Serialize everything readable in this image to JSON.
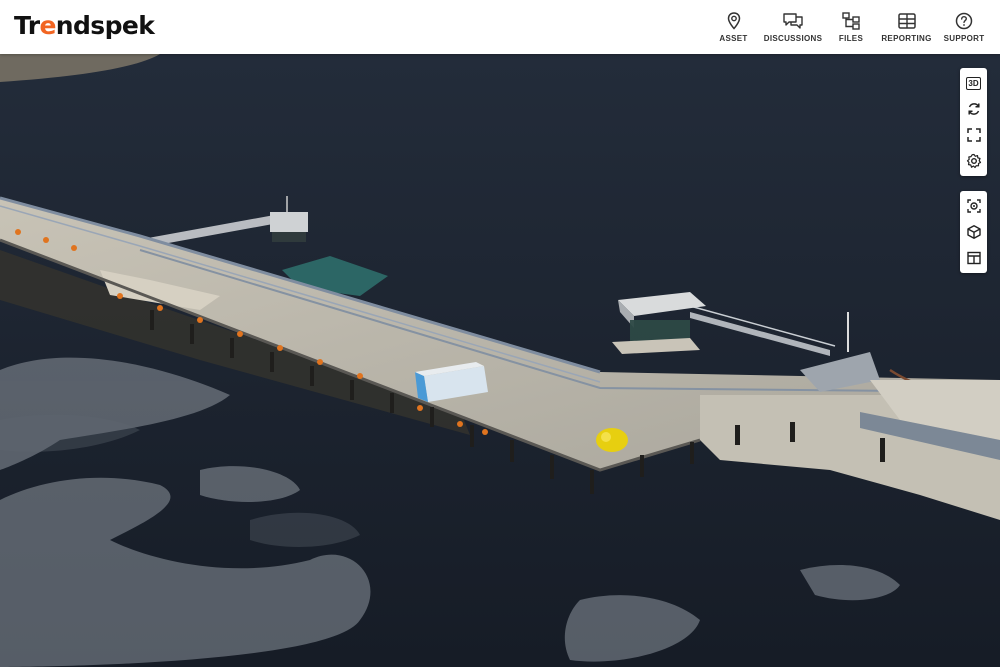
{
  "app": {
    "logo_main": "Tr",
    "logo_accent": "e",
    "logo_rest": "ndspek"
  },
  "nav": [
    {
      "label": "ASSET",
      "icon": "map-pin-icon"
    },
    {
      "label": "DISCUSSIONS",
      "icon": "chat-bubbles-icon"
    },
    {
      "label": "FILES",
      "icon": "folder-tree-icon"
    },
    {
      "label": "REPORTING",
      "icon": "table-icon"
    },
    {
      "label": "SUPPORT",
      "icon": "help-circle-icon"
    }
  ],
  "toolbar_top": [
    {
      "icon": "3d-view-icon",
      "text": "3D"
    },
    {
      "icon": "refresh-icon"
    },
    {
      "icon": "fullscreen-icon"
    },
    {
      "icon": "settings-icon"
    }
  ],
  "toolbar_bottom": [
    {
      "icon": "capture-icon"
    },
    {
      "icon": "cube-icon"
    },
    {
      "icon": "split-view-icon"
    }
  ],
  "colors": {
    "brand_accent": "#f26522",
    "water": "#1d2532",
    "header_bg": "#ffffff"
  }
}
